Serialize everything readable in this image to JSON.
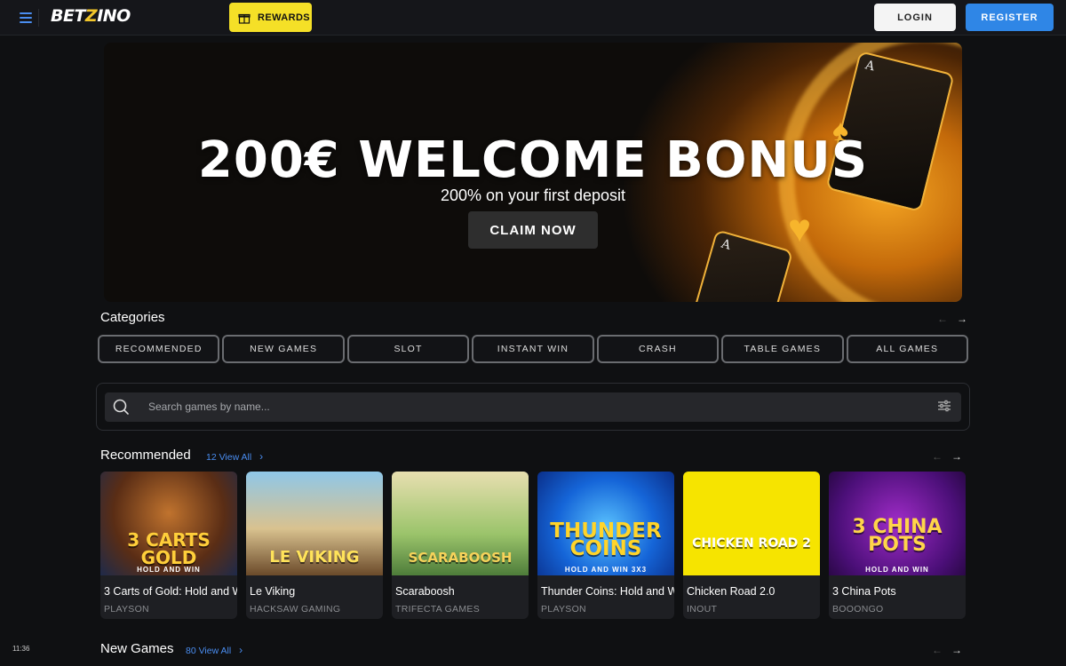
{
  "header": {
    "logo_text_a": "BET",
    "logo_text_b": "Z",
    "logo_text_c": "INO",
    "rewards_label": "REWARDS",
    "login_label": "LOGIN",
    "register_label": "REGISTER"
  },
  "banner": {
    "title": "200€ WELCOME BONUS",
    "subtitle": "200% on your first deposit",
    "cta_label": "CLAIM NOW"
  },
  "categories": {
    "title": "Categories",
    "items": [
      "RECOMMENDED",
      "NEW GAMES",
      "SLOT",
      "INSTANT WIN",
      "CRASH",
      "TABLE GAMES",
      "ALL GAMES"
    ]
  },
  "search": {
    "placeholder": "Search games by name..."
  },
  "recommended": {
    "title": "Recommended",
    "view_all": "12 View All",
    "games": [
      {
        "name": "3 Carts of Gold: Hold and W",
        "provider": "PLAYSON",
        "art_title": "3 CARTS GOLD",
        "art_sub": "HOLD AND WIN"
      },
      {
        "name": "Le Viking",
        "provider": "HACKSAW GAMING",
        "art_title": "LE VIKING",
        "art_sub": ""
      },
      {
        "name": "Scaraboosh",
        "provider": "TRIFECTA GAMES",
        "art_title": "SCARABOOSH",
        "art_sub": ""
      },
      {
        "name": "Thunder Coins: Hold and W",
        "provider": "PLAYSON",
        "art_title": "THUNDER COINS",
        "art_sub": "HOLD AND WIN 3X3"
      },
      {
        "name": "Chicken Road 2.0",
        "provider": "INOUT",
        "art_title": "CHICKEN ROAD 2",
        "art_sub": ""
      },
      {
        "name": "3 China Pots",
        "provider": "BOOONGO",
        "art_title": "3 CHINA POTS",
        "art_sub": "HOLD AND WIN"
      }
    ]
  },
  "new_games": {
    "title": "New Games",
    "view_all": "80 View All"
  },
  "clock": "11:36",
  "colors": {
    "accent_blue": "#2f86e6",
    "rewards_yellow": "#f5e027",
    "background": "#0f1012"
  }
}
